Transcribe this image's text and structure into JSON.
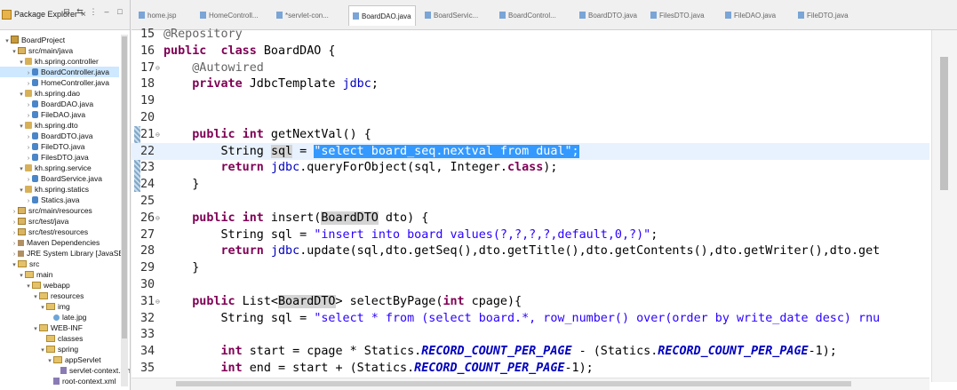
{
  "explorer": {
    "title": "Package Explorer",
    "close": "×",
    "tree": [
      {
        "arrow": "▾",
        "icon": "project",
        "label": "BoardProject",
        "indent": 0
      },
      {
        "arrow": "▾",
        "icon": "src-folder",
        "label": "src/main/java",
        "indent": 1
      },
      {
        "arrow": "▾",
        "icon": "package",
        "label": "kh.spring.controller",
        "indent": 2
      },
      {
        "arrow": "›",
        "icon": "java",
        "label": "BoardController.java",
        "indent": 3,
        "selected": true
      },
      {
        "arrow": "›",
        "icon": "java",
        "label": "HomeController.java",
        "indent": 3
      },
      {
        "arrow": "▾",
        "icon": "package",
        "label": "kh.spring.dao",
        "indent": 2
      },
      {
        "arrow": "›",
        "icon": "java",
        "label": "BoardDAO.java",
        "indent": 3
      },
      {
        "arrow": "›",
        "icon": "java",
        "label": "FileDAO.java",
        "indent": 3
      },
      {
        "arrow": "▾",
        "icon": "package",
        "label": "kh.spring.dto",
        "indent": 2
      },
      {
        "arrow": "›",
        "icon": "java",
        "label": "BoardDTO.java",
        "indent": 3
      },
      {
        "arrow": "›",
        "icon": "java",
        "label": "FileDTO.java",
        "indent": 3
      },
      {
        "arrow": "›",
        "icon": "java",
        "label": "FilesDTO.java",
        "indent": 3
      },
      {
        "arrow": "▾",
        "icon": "package",
        "label": "kh.spring.service",
        "indent": 2
      },
      {
        "arrow": "›",
        "icon": "java",
        "label": "BoardService.java",
        "indent": 3
      },
      {
        "arrow": "▾",
        "icon": "package",
        "label": "kh.spring.statics",
        "indent": 2
      },
      {
        "arrow": "›",
        "icon": "java",
        "label": "Statics.java",
        "indent": 3
      },
      {
        "arrow": "›",
        "icon": "src-folder",
        "label": "src/main/resources",
        "indent": 1
      },
      {
        "arrow": "›",
        "icon": "src-folder",
        "label": "src/test/java",
        "indent": 1
      },
      {
        "arrow": "›",
        "icon": "src-folder",
        "label": "src/test/resources",
        "indent": 1
      },
      {
        "arrow": "›",
        "icon": "library",
        "label": "Maven Dependencies",
        "indent": 1
      },
      {
        "arrow": "›",
        "icon": "library",
        "label": "JRE System Library [JavaSE",
        "indent": 1
      },
      {
        "arrow": "▾",
        "icon": "folder",
        "label": "src",
        "indent": 1
      },
      {
        "arrow": "▾",
        "icon": "folder",
        "label": "main",
        "indent": 2
      },
      {
        "arrow": "▾",
        "icon": "folder",
        "label": "webapp",
        "indent": 3
      },
      {
        "arrow": "▾",
        "icon": "folder",
        "label": "resources",
        "indent": 4
      },
      {
        "arrow": "▾",
        "icon": "folder",
        "label": "img",
        "indent": 5
      },
      {
        "arrow": "",
        "icon": "image",
        "label": "late.jpg",
        "indent": 6
      },
      {
        "arrow": "▾",
        "icon": "folder",
        "label": "WEB-INF",
        "indent": 4
      },
      {
        "arrow": "",
        "icon": "folder",
        "label": "classes",
        "indent": 5
      },
      {
        "arrow": "▾",
        "icon": "folder",
        "label": "spring",
        "indent": 5
      },
      {
        "arrow": "▾",
        "icon": "folder",
        "label": "appServlet",
        "indent": 6
      },
      {
        "arrow": "",
        "icon": "xml",
        "label": "servlet-context.xml",
        "indent": 7
      },
      {
        "arrow": "",
        "icon": "xml",
        "label": "root-context.xml",
        "indent": 6
      }
    ]
  },
  "tabs": [
    {
      "label": "home.jsp"
    },
    {
      "label": "HomeControll..."
    },
    {
      "label": "*servlet-con..."
    },
    {
      "label": "BoardDAO.java",
      "active": true
    },
    {
      "label": "BoardServic..."
    },
    {
      "label": "BoardControl..."
    },
    {
      "label": "BoardDTO.java"
    },
    {
      "label": "FilesDTO.java"
    },
    {
      "label": "FileDAO.java"
    },
    {
      "label": "FileDTO.java"
    }
  ],
  "code": [
    {
      "n": "15",
      "fold": "",
      "segs": [
        [
          "an",
          "@Repository"
        ]
      ]
    },
    {
      "n": "16",
      "fold": "",
      "segs": [
        [
          "kw",
          "public"
        ],
        [
          "",
          "  "
        ],
        [
          "kw",
          "class"
        ],
        [
          "",
          " BoardDAO {"
        ]
      ]
    },
    {
      "n": "17",
      "fold": "⊖",
      "segs": [
        [
          "",
          "    "
        ],
        [
          "an",
          "@Autowired"
        ]
      ]
    },
    {
      "n": "18",
      "fold": "",
      "segs": [
        [
          "",
          "    "
        ],
        [
          "kw",
          "private"
        ],
        [
          "",
          " JdbcTemplate "
        ],
        [
          "fl",
          "jdbc"
        ],
        [
          "",
          ";"
        ]
      ]
    },
    {
      "n": "19",
      "fold": "",
      "segs": []
    },
    {
      "n": "20",
      "fold": "",
      "segs": []
    },
    {
      "n": "21",
      "fold": "⊖",
      "segs": [
        [
          "",
          "    "
        ],
        [
          "kw",
          "public"
        ],
        [
          "",
          " "
        ],
        [
          "kw",
          "int"
        ],
        [
          "",
          " getNextVal() {"
        ]
      ]
    },
    {
      "n": "22",
      "fold": "",
      "hl": true,
      "segs": [
        [
          "",
          "        String "
        ],
        [
          "occ",
          "sql"
        ],
        [
          "",
          " = "
        ],
        [
          "sel-text",
          "\"select board_seq.nextval from dual\";"
        ]
      ]
    },
    {
      "n": "23",
      "fold": "",
      "segs": [
        [
          "",
          "        "
        ],
        [
          "kw",
          "return"
        ],
        [
          "",
          " "
        ],
        [
          "fl",
          "jdbc"
        ],
        [
          "",
          ".queryForObject(sql, Integer."
        ],
        [
          "kw",
          "class"
        ],
        [
          "",
          ");"
        ]
      ]
    },
    {
      "n": "24",
      "fold": "",
      "segs": [
        [
          "",
          "    }"
        ]
      ]
    },
    {
      "n": "25",
      "fold": "",
      "segs": []
    },
    {
      "n": "26",
      "fold": "⊖",
      "segs": [
        [
          "",
          "    "
        ],
        [
          "kw",
          "public"
        ],
        [
          "",
          " "
        ],
        [
          "kw",
          "int"
        ],
        [
          "",
          " insert("
        ],
        [
          "occ",
          "BoardDTO"
        ],
        [
          "",
          " dto) {"
        ]
      ]
    },
    {
      "n": "27",
      "fold": "",
      "segs": [
        [
          "",
          "        String sql = "
        ],
        [
          "st",
          "\"insert into board values(?,?,?,?,default,0,?)\""
        ],
        [
          "",
          ";"
        ]
      ]
    },
    {
      "n": "28",
      "fold": "",
      "segs": [
        [
          "",
          "        "
        ],
        [
          "kw",
          "return"
        ],
        [
          "",
          " "
        ],
        [
          "fl",
          "jdbc"
        ],
        [
          "",
          ".update(sql,dto.getSeq(),dto.getTitle(),dto.getContents(),dto.getWriter(),dto.get"
        ]
      ]
    },
    {
      "n": "29",
      "fold": "",
      "segs": [
        [
          "",
          "    }"
        ]
      ]
    },
    {
      "n": "30",
      "fold": "",
      "segs": []
    },
    {
      "n": "31",
      "fold": "⊖",
      "segs": [
        [
          "",
          "    "
        ],
        [
          "kw",
          "public"
        ],
        [
          "",
          " List<"
        ],
        [
          "occ",
          "BoardDTO"
        ],
        [
          "",
          "> selectByPage("
        ],
        [
          "kw",
          "int"
        ],
        [
          "",
          " cpage){"
        ]
      ]
    },
    {
      "n": "32",
      "fold": "",
      "segs": [
        [
          "",
          "        String sql = "
        ],
        [
          "st",
          "\"select * from (select board.*, row_number() over(order by write_date desc) rnu"
        ]
      ]
    },
    {
      "n": "33",
      "fold": "",
      "segs": []
    },
    {
      "n": "34",
      "fold": "",
      "segs": [
        [
          "",
          "        "
        ],
        [
          "kw",
          "int"
        ],
        [
          "",
          " start = cpage * Statics."
        ],
        [
          "cst",
          "RECORD_COUNT_PER_PAGE"
        ],
        [
          "",
          " - (Statics."
        ],
        [
          "cst",
          "RECORD_COUNT_PER_PAGE"
        ],
        [
          "",
          "-1);"
        ]
      ]
    },
    {
      "n": "35",
      "fold": "",
      "segs": [
        [
          "",
          "        "
        ],
        [
          "kw",
          "int"
        ],
        [
          "",
          " end = start + (Statics."
        ],
        [
          "cst",
          "RECORD_COUNT_PER_PAGE"
        ],
        [
          "",
          "-1);"
        ]
      ]
    }
  ],
  "colors": {
    "keyword": "#7f0055",
    "string": "#2a00ff",
    "field": "#0000c0",
    "annotation": "#646464",
    "selection": "#3399ff"
  }
}
